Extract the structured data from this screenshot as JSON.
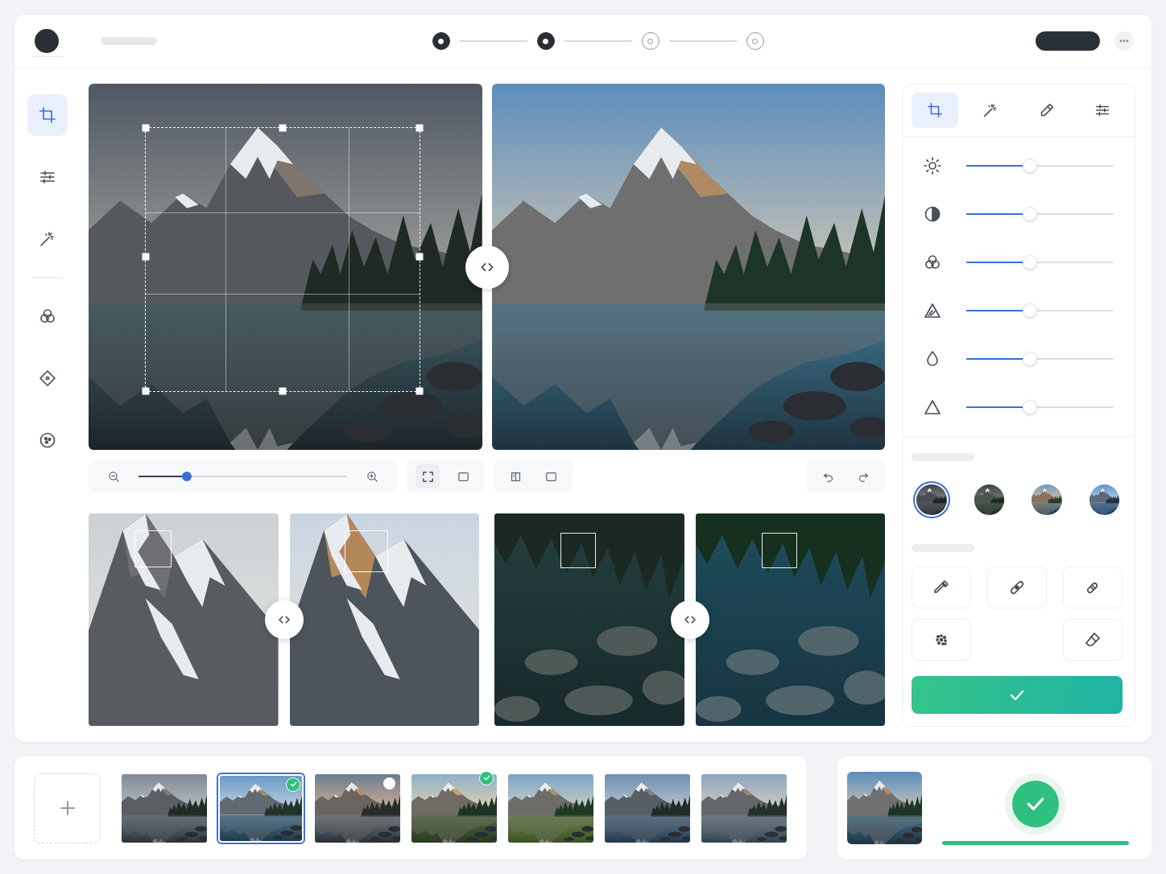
{
  "stepper": {
    "steps": [
      {
        "done": true
      },
      {
        "done": true
      },
      {
        "done": false
      },
      {
        "done": false
      }
    ]
  },
  "sidebar": {
    "items": [
      {
        "selected": true
      },
      {
        "selected": false
      },
      {
        "selected": false
      },
      {
        "selected": false
      },
      {
        "selected": false
      },
      {
        "selected": false
      }
    ]
  },
  "zoom": {
    "level": 0.23
  },
  "view_buttons": [
    {
      "selected": true
    },
    {
      "selected": false
    },
    {
      "selected": false
    },
    {
      "selected": false
    }
  ],
  "panel": {
    "tabs": [
      {
        "selected": true
      },
      {
        "selected": false
      },
      {
        "selected": false
      },
      {
        "selected": false
      }
    ],
    "adjustments": [
      {
        "level": 0.43
      },
      {
        "level": 0.43
      },
      {
        "level": 0.43
      },
      {
        "level": 0.43
      },
      {
        "level": 0.43
      },
      {
        "level": 0.43
      }
    ],
    "presets": [
      {
        "selected": true
      },
      {
        "selected": false
      },
      {
        "selected": false
      },
      {
        "selected": false
      }
    ]
  },
  "filmstrip": {
    "thumbnails": [
      {
        "selected": false,
        "badge": "none"
      },
      {
        "selected": true,
        "badge": "check"
      },
      {
        "selected": false,
        "badge": "dot"
      },
      {
        "selected": false,
        "badge": "check"
      },
      {
        "selected": false,
        "badge": "none"
      },
      {
        "selected": false,
        "badge": "none"
      },
      {
        "selected": false,
        "badge": "none"
      }
    ]
  },
  "export_status": {
    "done": true,
    "level": 1
  }
}
